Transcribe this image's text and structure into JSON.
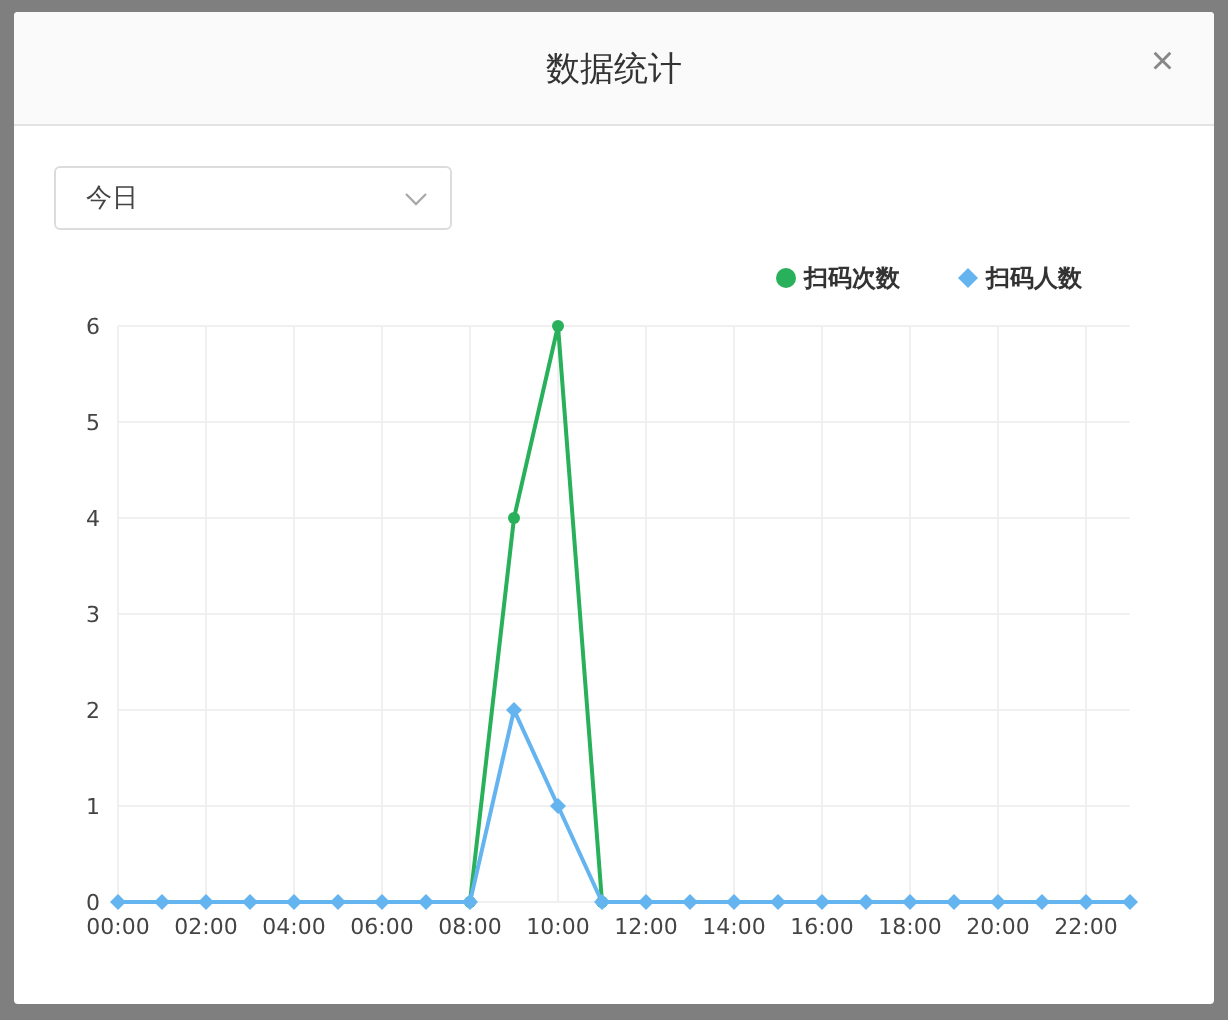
{
  "dialog": {
    "title": "数据统计",
    "close": "×"
  },
  "period_select": {
    "value": "今日"
  },
  "chart_data": {
    "type": "line",
    "x": [
      0,
      1,
      2,
      3,
      4,
      5,
      6,
      7,
      8,
      9,
      10,
      11,
      12,
      13,
      14,
      15,
      16,
      17,
      18,
      19,
      20,
      21,
      22,
      23
    ],
    "xticks": [
      {
        "value": 0,
        "label": "00:00"
      },
      {
        "value": 2,
        "label": "02:00"
      },
      {
        "value": 4,
        "label": "04:00"
      },
      {
        "value": 6,
        "label": "06:00"
      },
      {
        "value": 8,
        "label": "08:00"
      },
      {
        "value": 10,
        "label": "10:00"
      },
      {
        "value": 12,
        "label": "12:00"
      },
      {
        "value": 14,
        "label": "14:00"
      },
      {
        "value": 16,
        "label": "16:00"
      },
      {
        "value": 18,
        "label": "18:00"
      },
      {
        "value": 20,
        "label": "20:00"
      },
      {
        "value": 22,
        "label": "22:00"
      }
    ],
    "xlim": [
      0,
      23
    ],
    "ylim": [
      0,
      6
    ],
    "yticks": [
      0,
      1,
      2,
      3,
      4,
      5,
      6
    ],
    "grid": true,
    "legend": true,
    "series": [
      {
        "name": "扫码次数",
        "color": "#28b05a",
        "marker": "circle",
        "values": [
          null,
          null,
          null,
          null,
          null,
          null,
          null,
          null,
          0,
          4,
          6,
          0,
          null,
          null,
          null,
          null,
          null,
          null,
          null,
          null,
          null,
          null,
          null,
          null
        ]
      },
      {
        "name": "扫码人数",
        "color": "#64b4f0",
        "marker": "diamond",
        "values": [
          0,
          0,
          0,
          0,
          0,
          0,
          0,
          0,
          0,
          2,
          1,
          0,
          0,
          0,
          0,
          0,
          0,
          0,
          0,
          0,
          0,
          0,
          0,
          0
        ]
      }
    ]
  }
}
